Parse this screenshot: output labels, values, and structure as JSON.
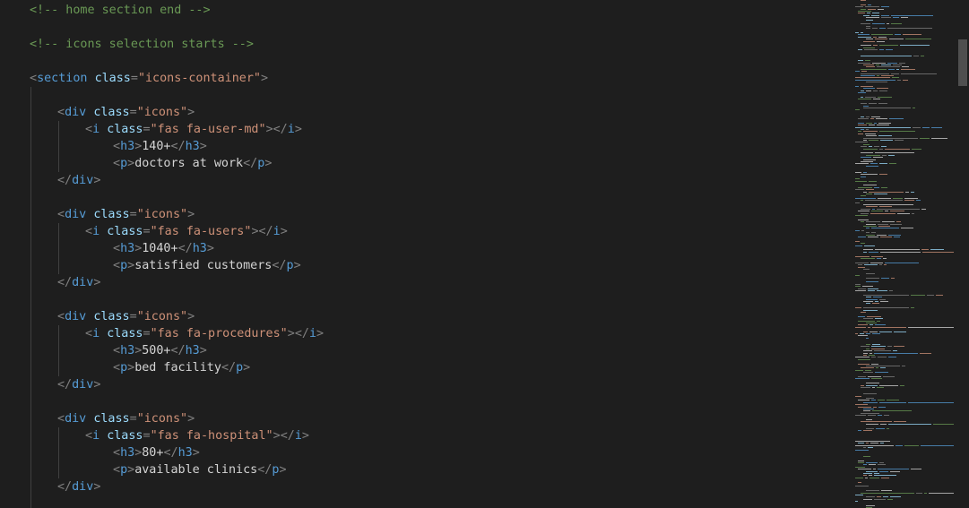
{
  "lines": [
    {
      "indent": 0,
      "kind": "comment",
      "text": "<!-- home section end -->"
    },
    {
      "indent": 0,
      "kind": "blank"
    },
    {
      "indent": 0,
      "kind": "comment",
      "text": "<!-- icons selection starts -->"
    },
    {
      "indent": 0,
      "kind": "blank"
    },
    {
      "indent": 0,
      "kind": "open",
      "tag": "section",
      "attr": "class",
      "value": "\"icons-container\""
    },
    {
      "indent": 0,
      "kind": "blank"
    },
    {
      "indent": 1,
      "kind": "open",
      "tag": "div",
      "attr": "class",
      "value": "\"icons\""
    },
    {
      "indent": 2,
      "kind": "pair",
      "tag": "i",
      "attr": "class",
      "value": "\"fas fa-user-md\"",
      "text": ""
    },
    {
      "indent": 3,
      "kind": "pair",
      "tag": "h3",
      "text": "140+"
    },
    {
      "indent": 3,
      "kind": "pair",
      "tag": "p",
      "text": "doctors at work"
    },
    {
      "indent": 1,
      "kind": "close",
      "tag": "div"
    },
    {
      "indent": 0,
      "kind": "blank"
    },
    {
      "indent": 1,
      "kind": "open",
      "tag": "div",
      "attr": "class",
      "value": "\"icons\""
    },
    {
      "indent": 2,
      "kind": "pair",
      "tag": "i",
      "attr": "class",
      "value": "\"fas fa-users\"",
      "text": ""
    },
    {
      "indent": 3,
      "kind": "pair",
      "tag": "h3",
      "text": "1040+"
    },
    {
      "indent": 3,
      "kind": "pair",
      "tag": "p",
      "text": "satisfied customers"
    },
    {
      "indent": 1,
      "kind": "close",
      "tag": "div"
    },
    {
      "indent": 0,
      "kind": "blank"
    },
    {
      "indent": 1,
      "kind": "open",
      "tag": "div",
      "attr": "class",
      "value": "\"icons\""
    },
    {
      "indent": 2,
      "kind": "pair",
      "tag": "i",
      "attr": "class",
      "value": "\"fas fa-procedures\"",
      "text": ""
    },
    {
      "indent": 3,
      "kind": "pair",
      "tag": "h3",
      "text": "500+"
    },
    {
      "indent": 3,
      "kind": "pair",
      "tag": "p",
      "text": "bed facility"
    },
    {
      "indent": 1,
      "kind": "close",
      "tag": "div"
    },
    {
      "indent": 0,
      "kind": "blank"
    },
    {
      "indent": 1,
      "kind": "open",
      "tag": "div",
      "attr": "class",
      "value": "\"icons\""
    },
    {
      "indent": 2,
      "kind": "pair",
      "tag": "i",
      "attr": "class",
      "value": "\"fas fa-hospital\"",
      "text": ""
    },
    {
      "indent": 3,
      "kind": "pair",
      "tag": "h3",
      "text": "80+"
    },
    {
      "indent": 3,
      "kind": "pair",
      "tag": "p",
      "text": "available clinics"
    },
    {
      "indent": 1,
      "kind": "close",
      "tag": "div"
    }
  ],
  "colors": {
    "background": "#1e1e1e",
    "comment": "#6a9955",
    "punctuation": "#808080",
    "tag": "#569cd6",
    "attribute": "#9cdcfe",
    "string": "#ce9178",
    "text": "#d4d4d4"
  }
}
